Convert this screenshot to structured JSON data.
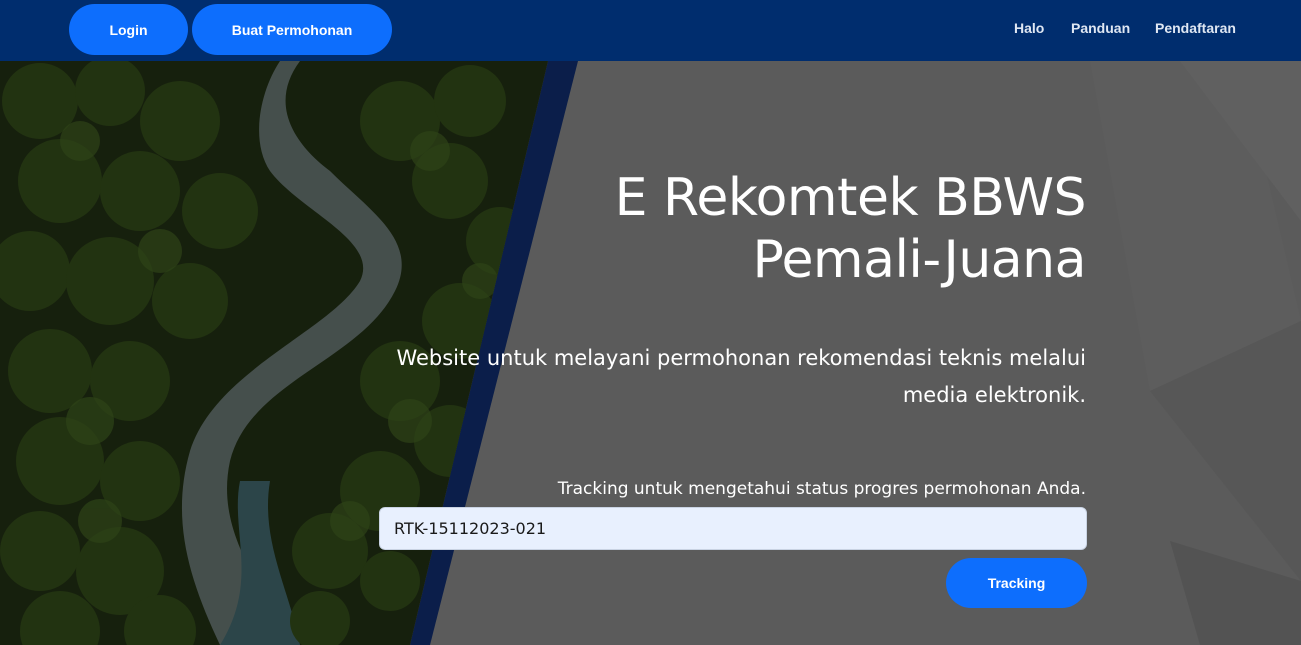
{
  "navbar": {
    "login_label": "Login",
    "buat_label": "Buat Permohonan",
    "links": [
      "Halo",
      "Panduan",
      "Pendaftaran"
    ]
  },
  "hero": {
    "title_line1": "E Rekomtek BBWS",
    "title_line2": "Pemali-Juana",
    "subtitle_line1": "Website untuk melayani permohonan rekomendasi teknis melalui",
    "subtitle_line2": "media elektronik.",
    "tracking_label": "Tracking untuk mengetahui status progres permohonan Anda.",
    "tracking_value": "RTK-15112023-021",
    "tracking_button": "Tracking"
  },
  "colors": {
    "navbar_bg": "#002d6e",
    "button_blue": "#0d6efd",
    "hero_gray": "#5b5b5b",
    "diagonal_band": "#0b1e4a"
  }
}
